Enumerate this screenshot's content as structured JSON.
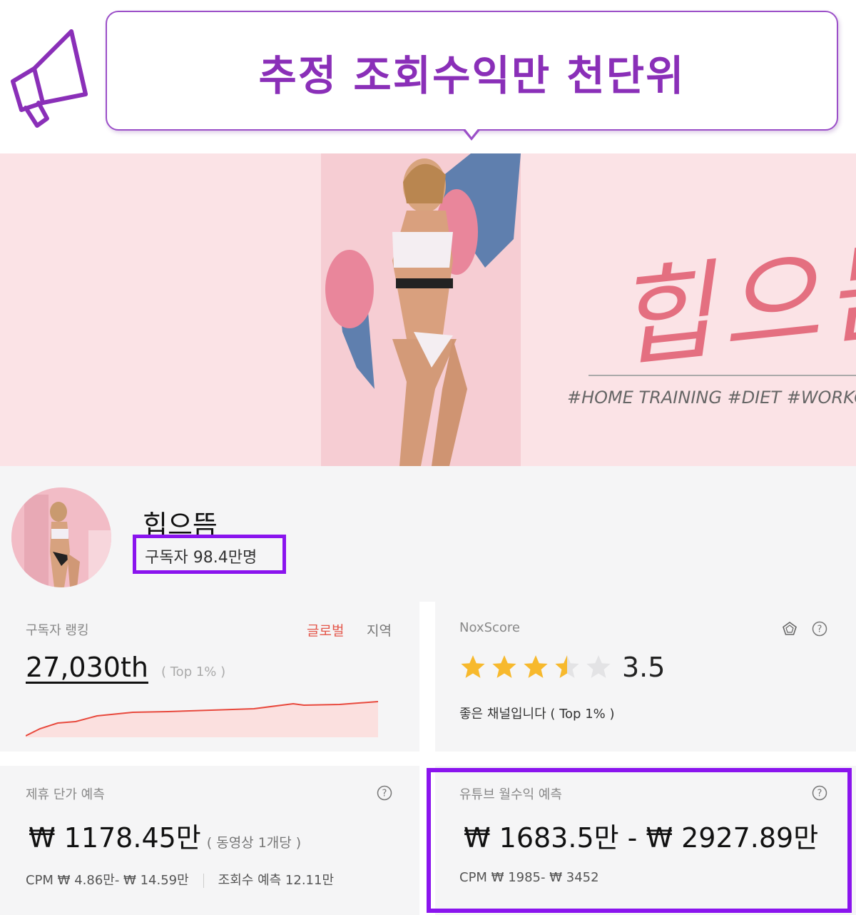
{
  "header": {
    "title": "추정 조회수익만 천단위",
    "icon": "megaphone-icon",
    "accent_color": "#8a2fb8"
  },
  "banner": {
    "logo_text": "힙으뜸",
    "tags": "#HOME TRAINING #DIET #WORKOU"
  },
  "channel": {
    "name": "힙으뜸",
    "subscribers": "구독자 98.4만명"
  },
  "ranking": {
    "label": "구독자 랭킹",
    "tab_global": "글로벌",
    "tab_region": "지역",
    "value": "27,030th",
    "top": "( Top 1% )",
    "trend_color": "#e8493d"
  },
  "noxscore": {
    "label": "NoxScore",
    "rating": 3.5,
    "score": "3.5",
    "desc": "좋은 채널입니다 ( Top 1% )"
  },
  "deal": {
    "label": "제휴 단가 예측",
    "value": "₩ 1178.45만",
    "note": "( 동영상 1개당 )",
    "cpm": "CPM   ₩ 4.86만- ₩ 14.59만",
    "views": "조회수 예측   12.11만"
  },
  "youtube": {
    "label": "유튜브 월수익 예측",
    "value": "₩ 1683.5만 - ₩ 2927.89만",
    "cpm": "CPM   ₩ 1985- ₩ 3452",
    "highlight_color": "#8a14ee"
  }
}
